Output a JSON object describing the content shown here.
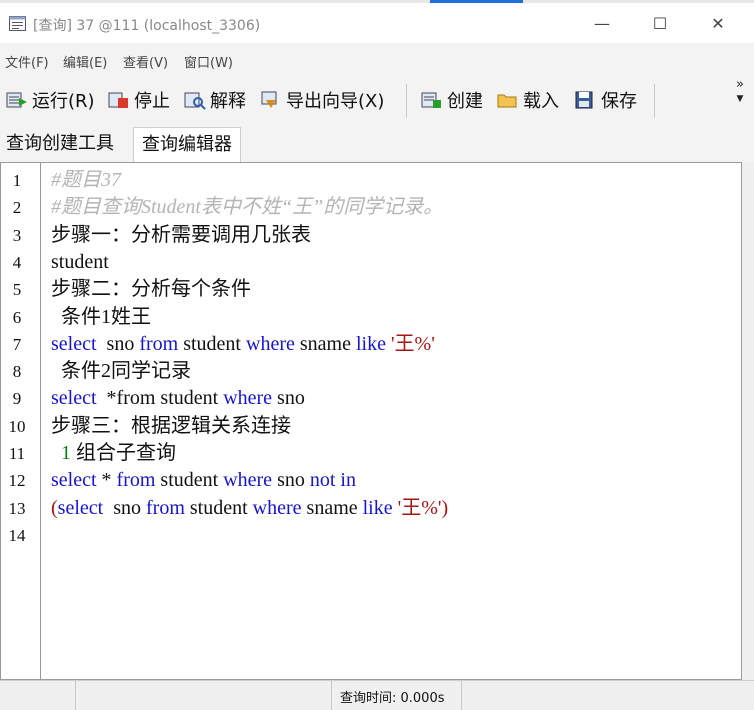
{
  "window": {
    "title": "[查询] 37 @111 (localhost_3306)",
    "minimize": "—",
    "maximize": "☐",
    "close": "✕"
  },
  "menu": [
    {
      "label": "文件(F)"
    },
    {
      "label": "编辑(E)"
    },
    {
      "label": "查看(V)"
    },
    {
      "label": "窗口(W)"
    }
  ],
  "toolbar": {
    "run": "运行(R)",
    "stop": "停止",
    "explain": "解释",
    "export_wizard": "导出向导(X)",
    "create": "创建",
    "load": "载入",
    "save": "保存",
    "more": "»"
  },
  "tabs": [
    {
      "label": "查询创建工具",
      "active": false
    },
    {
      "label": "查询编辑器",
      "active": true
    }
  ],
  "editor": {
    "line_numbers": [
      "1",
      "2",
      "3",
      "4",
      "5",
      "6",
      "7",
      "8",
      "9",
      "10",
      "11",
      "12",
      "13",
      "14"
    ],
    "lines": [
      [
        {
          "t": "#题目37",
          "c": "cm"
        }
      ],
      [
        {
          "t": "#题目查询Student表中不姓“王”的同学记录。",
          "c": "cm"
        }
      ],
      [
        {
          "t": "步骤一：分析需要调用几张表",
          "c": ""
        }
      ],
      [
        {
          "t": "student",
          "c": ""
        }
      ],
      [
        {
          "t": "步骤二：分析每个条件",
          "c": ""
        }
      ],
      [
        {
          "t": "  条件1姓王",
          "c": ""
        }
      ],
      [
        {
          "t": "select",
          "c": "kw"
        },
        {
          "t": "  sno ",
          "c": ""
        },
        {
          "t": "from",
          "c": "kw"
        },
        {
          "t": " student ",
          "c": ""
        },
        {
          "t": "where",
          "c": "kw"
        },
        {
          "t": " sname ",
          "c": ""
        },
        {
          "t": "like",
          "c": "kw"
        },
        {
          "t": " '王%'",
          "c": "str"
        }
      ],
      [
        {
          "t": "  条件2同学记录",
          "c": ""
        }
      ],
      [
        {
          "t": "select",
          "c": "kw"
        },
        {
          "t": "  *from student ",
          "c": ""
        },
        {
          "t": "where",
          "c": "kw"
        },
        {
          "t": " sno",
          "c": ""
        }
      ],
      [
        {
          "t": "步骤三：根据逻辑关系连接",
          "c": ""
        }
      ],
      [
        {
          "t": "  ",
          "c": ""
        },
        {
          "t": "1",
          "c": "num"
        },
        {
          "t": " 组合子查询",
          "c": ""
        }
      ],
      [
        {
          "t": "select",
          "c": "kw"
        },
        {
          "t": " * ",
          "c": ""
        },
        {
          "t": "from",
          "c": "kw"
        },
        {
          "t": " student ",
          "c": ""
        },
        {
          "t": "where",
          "c": "kw"
        },
        {
          "t": " sno ",
          "c": ""
        },
        {
          "t": "not in",
          "c": "kw"
        }
      ],
      [
        {
          "t": "(",
          "c": "par"
        },
        {
          "t": "select",
          "c": "kw"
        },
        {
          "t": "  sno ",
          "c": ""
        },
        {
          "t": "from",
          "c": "kw"
        },
        {
          "t": " student ",
          "c": ""
        },
        {
          "t": "where",
          "c": "kw"
        },
        {
          "t": " sname ",
          "c": ""
        },
        {
          "t": "like",
          "c": "kw"
        },
        {
          "t": " '王%'",
          "c": "str"
        },
        {
          "t": ")",
          "c": "par"
        }
      ],
      []
    ]
  },
  "status": {
    "query_time": "查询时间: 0.000s"
  },
  "colors": {
    "keyword": "#1515cc",
    "string": "#a31515",
    "comment": "#b4b4b4",
    "number": "#0c7a0c"
  }
}
